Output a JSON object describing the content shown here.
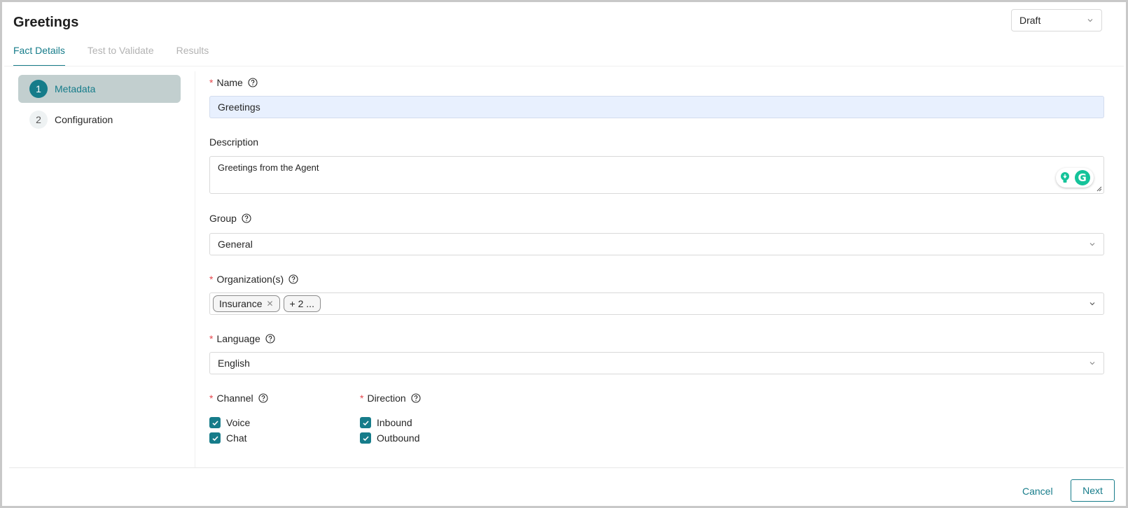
{
  "page": {
    "title": "Greetings"
  },
  "status": {
    "selected": "Draft"
  },
  "tabs": [
    {
      "label": "Fact Details"
    },
    {
      "label": "Test to Validate"
    },
    {
      "label": "Results"
    }
  ],
  "steps": [
    {
      "number": "1",
      "label": "Metadata"
    },
    {
      "number": "2",
      "label": "Configuration"
    }
  ],
  "form": {
    "name": {
      "label": "Name",
      "value": "Greetings"
    },
    "description": {
      "label": "Description",
      "value": "Greetings from the Agent"
    },
    "group": {
      "label": "Group",
      "value": "General"
    },
    "organizations": {
      "label": "Organization(s)",
      "tags": [
        "Insurance"
      ],
      "more": "+ 2 ..."
    },
    "language": {
      "label": "Language",
      "value": "English"
    },
    "channel": {
      "label": "Channel",
      "options": [
        "Voice",
        "Chat"
      ]
    },
    "direction": {
      "label": "Direction",
      "options": [
        "Inbound",
        "Outbound"
      ]
    }
  },
  "footer": {
    "cancel_label": "Cancel",
    "next_label": "Next"
  },
  "icons": {
    "help": "question-circle-icon",
    "chevron": "chevron-down-icon",
    "check": "check-icon",
    "grammarly": "grammarly-icon"
  },
  "colors": {
    "accent": "#167c8a",
    "required": "#e5484d",
    "filled_input": "#e8f0fe"
  }
}
